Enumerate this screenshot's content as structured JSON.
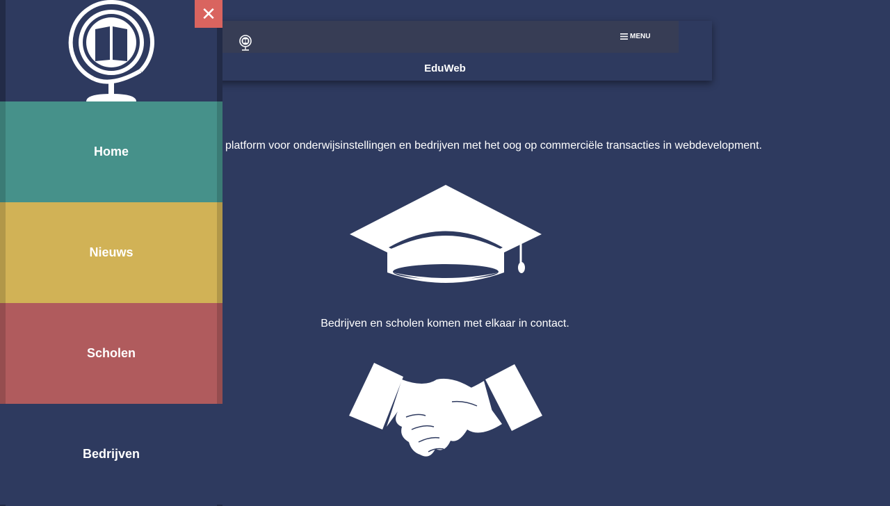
{
  "header": {
    "title": "EduWeb",
    "menu_label": "MENU"
  },
  "content": {
    "intro": "platform voor onderwijsinstellingen en bedrijven met het oog op commerciële transacties in webdevelopment.",
    "contact_line": "Bedrijven en scholen komen met elkaar in contact."
  },
  "drawer": {
    "close_symbol": "✕",
    "items": [
      {
        "label": "Home",
        "color": "#46918a"
      },
      {
        "label": "Nieuws",
        "color": "#d1b256"
      },
      {
        "label": "Scholen",
        "color": "#b05b5d"
      },
      {
        "label": "Bedrijven",
        "color": "#2e3a5f"
      }
    ]
  },
  "colors": {
    "background": "#2e3a5f",
    "topbar": "#373d55",
    "close_button": "#d9645f"
  },
  "icons": [
    "globe-book-logo-icon",
    "menu-icon",
    "graduation-cap-icon",
    "handshake-icon",
    "close-icon"
  ]
}
